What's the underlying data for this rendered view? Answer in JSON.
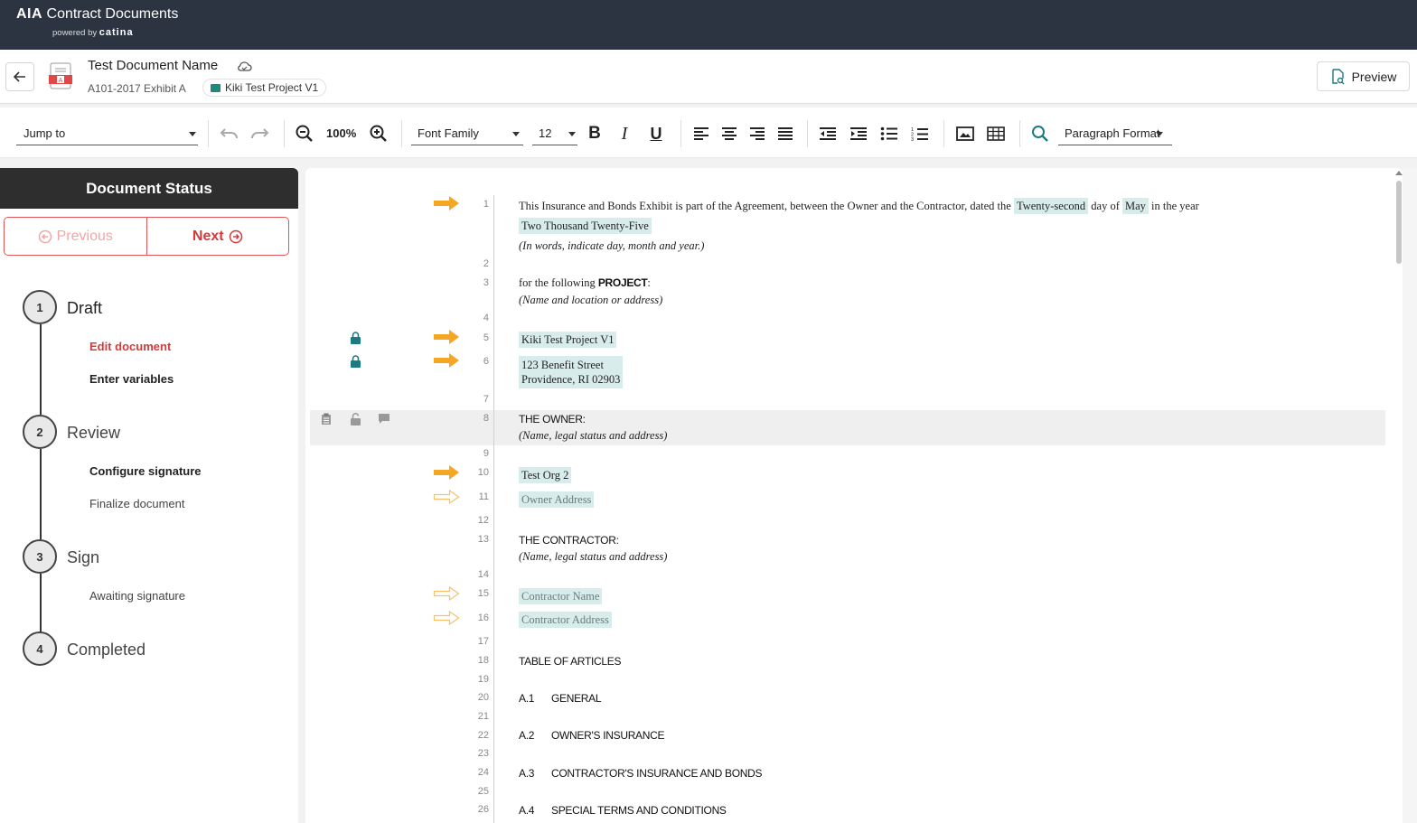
{
  "brand": {
    "title_bold": "AIA",
    "title_rest": " Contract Documents",
    "powered_by": "powered by",
    "powered_name": "catina"
  },
  "header": {
    "document_name": "Test Document Name",
    "document_code": "A101-2017 Exhibit A",
    "project_name": "Kiki Test Project V1",
    "preview_label": "Preview"
  },
  "toolbar": {
    "jump_to": "Jump to",
    "zoom": "100%",
    "font_family": "Font Family",
    "font_size": "12",
    "bold": "B",
    "italic": "I",
    "underline": "U",
    "paragraph_format": "Paragraph Format"
  },
  "status_panel": {
    "title": "Document Status",
    "previous_label": "Previous",
    "next_label": "Next",
    "steps": [
      {
        "number": "1",
        "label": "Draft",
        "items": [
          "Edit document",
          "Enter variables"
        ]
      },
      {
        "number": "2",
        "label": "Review",
        "items": [
          "Configure signature",
          "Finalize document"
        ]
      },
      {
        "number": "3",
        "label": "Sign",
        "items": [
          "Awaiting signature"
        ]
      },
      {
        "number": "4",
        "label": "Completed",
        "items": []
      }
    ]
  },
  "document": {
    "line_numbers": [
      "1",
      "2",
      "3",
      "4",
      "5",
      "6",
      "7",
      "8",
      "9",
      "10",
      "11",
      "12",
      "13",
      "14",
      "15",
      "16",
      "17",
      "18",
      "19",
      "20",
      "21",
      "22",
      "23",
      "24",
      "25",
      "26"
    ],
    "l1_text": "This Insurance and Bonds Exhibit is part of the Agreement, between the Owner and the Contractor, dated the",
    "l1_day": "Twenty-second",
    "l1_day_of": "day of",
    "l1_month": "May",
    "l1_in_year": "in the year",
    "l1_year": "Two Thousand Twenty-Five",
    "l1_hint": "(In words, indicate day, month and year.)",
    "l3_text": "for the following",
    "l3_bold": "PROJECT",
    "l3_colon": ":",
    "l3_hint": "(Name and location or address)",
    "l5_value": "Kiki Test Project V1",
    "l6_value_1": "123 Benefit Street",
    "l6_value_2": "Providence, RI 02903",
    "l8_heading": "THE OWNER:",
    "l8_hint": "(Name, legal status and address)",
    "l10_value": "Test Org 2",
    "l11_value": "Owner Address",
    "l13_heading": "THE CONTRACTOR:",
    "l13_hint": "(Name, legal status and address)",
    "l15_value": "Contractor Name",
    "l16_value": "Contractor Address",
    "l18_heading": "TABLE OF ARTICLES",
    "articles": [
      {
        "num": "A.1",
        "title": "GENERAL"
      },
      {
        "num": "A.2",
        "title": "OWNER'S INSURANCE"
      },
      {
        "num": "A.3",
        "title": "CONTRACTOR'S INSURANCE AND BONDS"
      },
      {
        "num": "A.4",
        "title": "SPECIAL TERMS AND CONDITIONS"
      }
    ]
  },
  "colors": {
    "brand_bar": "#2b3440",
    "accent_red": "#d33b3b",
    "marker_orange": "#f5a623",
    "teal": "#1f7a80",
    "variable_bg": "#d8ecec"
  }
}
